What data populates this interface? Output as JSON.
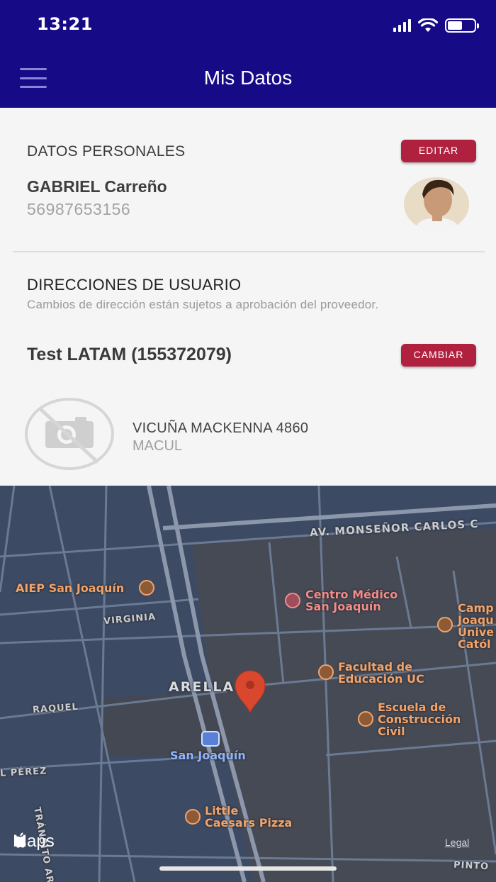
{
  "status_bar": {
    "time": "13:21"
  },
  "header": {
    "title": "Mis Datos"
  },
  "personal": {
    "section_title": "DATOS PERSONALES",
    "edit_label": "EDITAR",
    "name": "GABRIEL Carreño",
    "phone": "56987653156"
  },
  "addresses": {
    "section_title": "DIRECCIONES DE USUARIO",
    "subtitle": "Cambios de dirección están sujetos a aprobación del proveedor.",
    "account": "Test LATAM (155372079)",
    "change_label": "CAMBIAR",
    "street": "VICUÑA MACKENNA 4860",
    "city": "MACUL"
  },
  "map": {
    "labels": {
      "av_monsenor": "AV. MONSEÑOR CARLOS C",
      "aiep": "AIEP San Joaquín",
      "centro_medico": "Centro Médico\nSan Joaquín",
      "campus": "Camp\nJoaqu\nUnive\nCatól",
      "virginia": "VIRGINIA",
      "facultad": "Facultad de\nEducación UC",
      "arellano": "ARELLA",
      "raquel": "RAQUEL",
      "escuela": "Escuela de\nConstrucción\nCivil",
      "san_joaquin_station": "San Joaquín",
      "perez": "L PÉREZ",
      "transito": "TRÁNSITO ARAOS",
      "little_caesars": "Little\nCaesars Pizza",
      "pinto": "PINTO"
    },
    "brand": "Maps",
    "legal": "Legal"
  },
  "colors": {
    "header": "#170a86",
    "accent": "#b0213f",
    "map_bg": "#3c4a63",
    "pin": "#d9472f"
  }
}
